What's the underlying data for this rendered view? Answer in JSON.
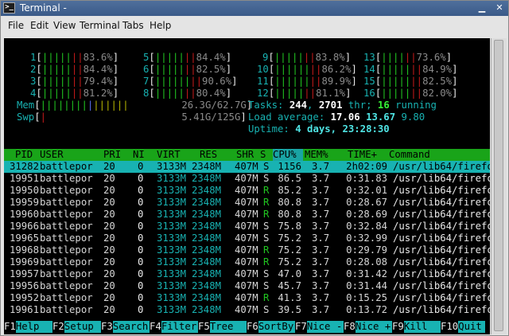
{
  "window": {
    "title": "Terminal -",
    "icon": "terminal-icon"
  },
  "menu": [
    "File",
    "Edit",
    "View",
    "Terminal",
    "Tabs",
    "Help"
  ],
  "cpus": [
    {
      "num": "1",
      "pct": "83.6%"
    },
    {
      "num": "2",
      "pct": "84.4%"
    },
    {
      "num": "3",
      "pct": "79.4%"
    },
    {
      "num": "4",
      "pct": "81.2%"
    },
    {
      "num": "5",
      "pct": "84.4%"
    },
    {
      "num": "6",
      "pct": "82.5%"
    },
    {
      "num": "7",
      "pct": "90.6%"
    },
    {
      "num": "8",
      "pct": "80.4%"
    },
    {
      "num": "9",
      "pct": "83.8%"
    },
    {
      "num": "10",
      "pct": "86.2%"
    },
    {
      "num": "11",
      "pct": "89.9%"
    },
    {
      "num": "12",
      "pct": "81.1%"
    },
    {
      "num": "13",
      "pct": "73.6%"
    },
    {
      "num": "14",
      "pct": "84.9%"
    },
    {
      "num": "15",
      "pct": "82.5%"
    },
    {
      "num": "16",
      "pct": "82.0%"
    }
  ],
  "mem": {
    "label": "Mem",
    "used": "26.3G",
    "total": "62.7G"
  },
  "swp": {
    "label": "Swp",
    "used": "5.41G",
    "total": "125G"
  },
  "tasks": {
    "label": "Tasks:",
    "count": "244",
    "thr": "2701",
    "thr_label": "thr;",
    "running": "16",
    "running_label": "running"
  },
  "load": {
    "label": "Load average:",
    "a1": "17.06",
    "a5": "13.67",
    "a15": "9.80"
  },
  "uptime": {
    "label": "Uptime:",
    "value": "4 days, 23:28:30"
  },
  "columns": [
    "PID",
    "USER",
    "PRI",
    "NI",
    "VIRT",
    "RES",
    "SHR",
    "S",
    "CPU%",
    "MEM%",
    "TIME+",
    "Command"
  ],
  "processes": [
    {
      "pid": "31282",
      "user": "battlepor",
      "pri": "20",
      "ni": "0",
      "virt": "3133M",
      "res": "2348M",
      "shr": "407M",
      "s": "S",
      "cpu": "1156",
      "mem": "3.7",
      "time": "2h02:09",
      "cmd": "/usr/lib64/firefo"
    },
    {
      "pid": "19951",
      "user": "battlepor",
      "pri": "20",
      "ni": "0",
      "virt": "3133M",
      "res": "2348M",
      "shr": "407M",
      "s": "S",
      "cpu": "86.5",
      "mem": "3.7",
      "time": "0:31.83",
      "cmd": "/usr/lib64/firefo"
    },
    {
      "pid": "19950",
      "user": "battlepor",
      "pri": "20",
      "ni": "0",
      "virt": "3133M",
      "res": "2348M",
      "shr": "407M",
      "s": "R",
      "cpu": "85.2",
      "mem": "3.7",
      "time": "0:32.01",
      "cmd": "/usr/lib64/firefo"
    },
    {
      "pid": "19959",
      "user": "battlepor",
      "pri": "20",
      "ni": "0",
      "virt": "3133M",
      "res": "2348M",
      "shr": "407M",
      "s": "R",
      "cpu": "80.8",
      "mem": "3.7",
      "time": "0:28.67",
      "cmd": "/usr/lib64/firefo"
    },
    {
      "pid": "19960",
      "user": "battlepor",
      "pri": "20",
      "ni": "0",
      "virt": "3133M",
      "res": "2348M",
      "shr": "407M",
      "s": "R",
      "cpu": "80.8",
      "mem": "3.7",
      "time": "0:28.69",
      "cmd": "/usr/lib64/firefo"
    },
    {
      "pid": "19966",
      "user": "battlepor",
      "pri": "20",
      "ni": "0",
      "virt": "3133M",
      "res": "2348M",
      "shr": "407M",
      "s": "S",
      "cpu": "75.8",
      "mem": "3.7",
      "time": "0:32.84",
      "cmd": "/usr/lib64/firefo"
    },
    {
      "pid": "19965",
      "user": "battlepor",
      "pri": "20",
      "ni": "0",
      "virt": "3133M",
      "res": "2348M",
      "shr": "407M",
      "s": "S",
      "cpu": "75.2",
      "mem": "3.7",
      "time": "0:32.99",
      "cmd": "/usr/lib64/firefo"
    },
    {
      "pid": "19968",
      "user": "battlepor",
      "pri": "20",
      "ni": "0",
      "virt": "3133M",
      "res": "2348M",
      "shr": "407M",
      "s": "R",
      "cpu": "75.2",
      "mem": "3.7",
      "time": "0:29.79",
      "cmd": "/usr/lib64/firefo"
    },
    {
      "pid": "19969",
      "user": "battlepor",
      "pri": "20",
      "ni": "0",
      "virt": "3133M",
      "res": "2348M",
      "shr": "407M",
      "s": "R",
      "cpu": "75.2",
      "mem": "3.7",
      "time": "0:28.08",
      "cmd": "/usr/lib64/firefo"
    },
    {
      "pid": "19957",
      "user": "battlepor",
      "pri": "20",
      "ni": "0",
      "virt": "3133M",
      "res": "2348M",
      "shr": "407M",
      "s": "S",
      "cpu": "47.0",
      "mem": "3.7",
      "time": "0:31.42",
      "cmd": "/usr/lib64/firefo"
    },
    {
      "pid": "19956",
      "user": "battlepor",
      "pri": "20",
      "ni": "0",
      "virt": "3133M",
      "res": "2348M",
      "shr": "407M",
      "s": "S",
      "cpu": "45.7",
      "mem": "3.7",
      "time": "0:31.44",
      "cmd": "/usr/lib64/firefo"
    },
    {
      "pid": "19952",
      "user": "battlepor",
      "pri": "20",
      "ni": "0",
      "virt": "3133M",
      "res": "2348M",
      "shr": "407M",
      "s": "R",
      "cpu": "41.3",
      "mem": "3.7",
      "time": "0:15.25",
      "cmd": "/usr/lib64/firefo"
    },
    {
      "pid": "19961",
      "user": "battlepor",
      "pri": "20",
      "ni": "0",
      "virt": "3133M",
      "res": "2348M",
      "shr": "407M",
      "s": "S",
      "cpu": "39.5",
      "mem": "3.7",
      "time": "0:13.72",
      "cmd": "/usr/lib64/firefo"
    }
  ],
  "fkeys": [
    {
      "key": "F1",
      "label": "Help"
    },
    {
      "key": "F2",
      "label": "Setup"
    },
    {
      "key": "F3",
      "label": "Search"
    },
    {
      "key": "F4",
      "label": "Filter"
    },
    {
      "key": "F5",
      "label": "Tree"
    },
    {
      "key": "F6",
      "label": "SortBy"
    },
    {
      "key": "F7",
      "label": "Nice -"
    },
    {
      "key": "F8",
      "label": "Nice +"
    },
    {
      "key": "F9",
      "label": "Kill"
    },
    {
      "key": "F10",
      "label": "Quit"
    }
  ],
  "colors": {
    "header_bg": "#19a419",
    "selected_bg": "#18b2b2",
    "terminal_bg": "#000000",
    "titlebar": "#3a5a88"
  }
}
